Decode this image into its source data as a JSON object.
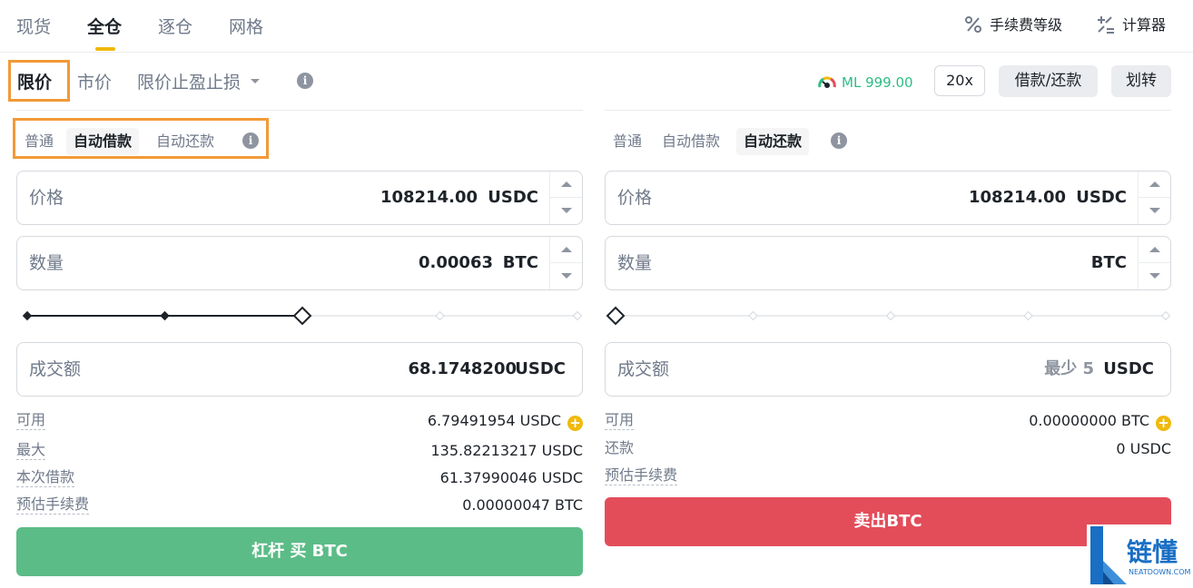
{
  "top_tabs": [
    "现货",
    "全仓",
    "逐仓",
    "网格"
  ],
  "tools": {
    "fee_level": "手续费等级",
    "calculator": "计算器"
  },
  "order_types": {
    "limit": "限价",
    "market": "市价",
    "stop_limit": "限价止盈止损"
  },
  "account": {
    "margin_level": "ML 999.00",
    "leverage": "20x",
    "borrow_repay": "借款/还款",
    "transfer": "划转"
  },
  "buy": {
    "modes": [
      "普通",
      "自动借款",
      "自动还款"
    ],
    "active_mode": "自动借款",
    "price_label": "价格",
    "price_value": "108214.00",
    "price_unit": "USDC",
    "amount_label": "数量",
    "amount_value": "0.00063",
    "amount_unit": "BTC",
    "slider_percent": 50,
    "total_label": "成交额",
    "total_value": "68.1748200",
    "total_unit": "USDC",
    "rows": [
      {
        "label": "可用",
        "value": "6.79491954 USDC"
      },
      {
        "label": "最大",
        "value": "135.82213217 USDC"
      },
      {
        "label": "本次借款",
        "value": "61.37990046 USDC"
      },
      {
        "label": "预估手续费",
        "value": "0.00000047 BTC"
      }
    ],
    "button": "杠杆 买 BTC"
  },
  "sell": {
    "modes": [
      "普通",
      "自动借款",
      "自动还款"
    ],
    "active_mode": "自动还款",
    "price_label": "价格",
    "price_value": "108214.00",
    "price_unit": "USDC",
    "amount_label": "数量",
    "amount_value": "",
    "amount_unit": "BTC",
    "slider_percent": 0,
    "total_label": "成交额",
    "total_placeholder": "最少 5",
    "total_unit": "USDC",
    "rows": [
      {
        "label": "可用",
        "value": "0.00000000 BTC"
      },
      {
        "label": "还款",
        "value": "0 USDC"
      },
      {
        "label": "预估手续费",
        "value": ""
      }
    ],
    "button": "卖出BTC"
  },
  "watermark": {
    "text": "链懂",
    "sub": "NEATDOWN.COM"
  },
  "colors": {
    "accent": "#f0b90b",
    "buy": "#5cbc87",
    "sell": "#e34d5a",
    "highlight": "#f19a38",
    "ml": "#2ebd85"
  }
}
